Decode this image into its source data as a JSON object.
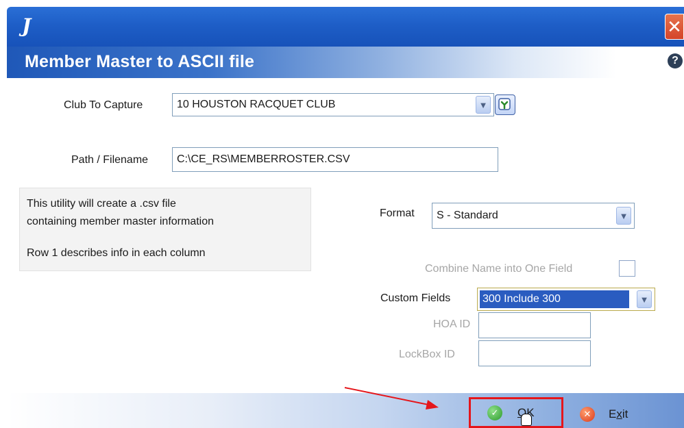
{
  "window": {
    "app_logo": "J",
    "close_glyph": "✕",
    "title": "Member Master to ASCII file",
    "help_glyph": "?"
  },
  "form": {
    "club_label": "Club To Capture",
    "club_value": "10 HOUSTON RACQUET CLUB",
    "path_label": "Path / Filename",
    "path_value": "C:\\CE_RS\\MEMBERROSTER.CSV",
    "info_lines": [
      "This utility will create a .csv file",
      "containing member master information",
      "Row 1 describes info in each column"
    ],
    "format_label": "Format",
    "format_value": "S - Standard",
    "combine_label": "Combine Name into One Field",
    "combine_checked": false,
    "custom_fields_label": "Custom Fields",
    "custom_fields_value": "300 Include 300",
    "hoa_label": "HOA ID",
    "hoa_value": "",
    "lockbox_label": "LockBox ID",
    "lockbox_value": ""
  },
  "footer": {
    "ok_label_accel": "O",
    "ok_label_rest": "K",
    "exit_label_pre": "E",
    "exit_label_accel": "x",
    "exit_label_rest": "it"
  },
  "colors": {
    "titlebar": "#1e5ec7",
    "highlight_border": "#e5161b",
    "selection": "#2a5cc0"
  },
  "icons": {
    "dropdown": "chevron-down-icon",
    "lookup": "lookup-icon",
    "ok": "check-circle-icon",
    "exit": "close-circle-icon",
    "cursor": "hand-cursor-icon"
  }
}
